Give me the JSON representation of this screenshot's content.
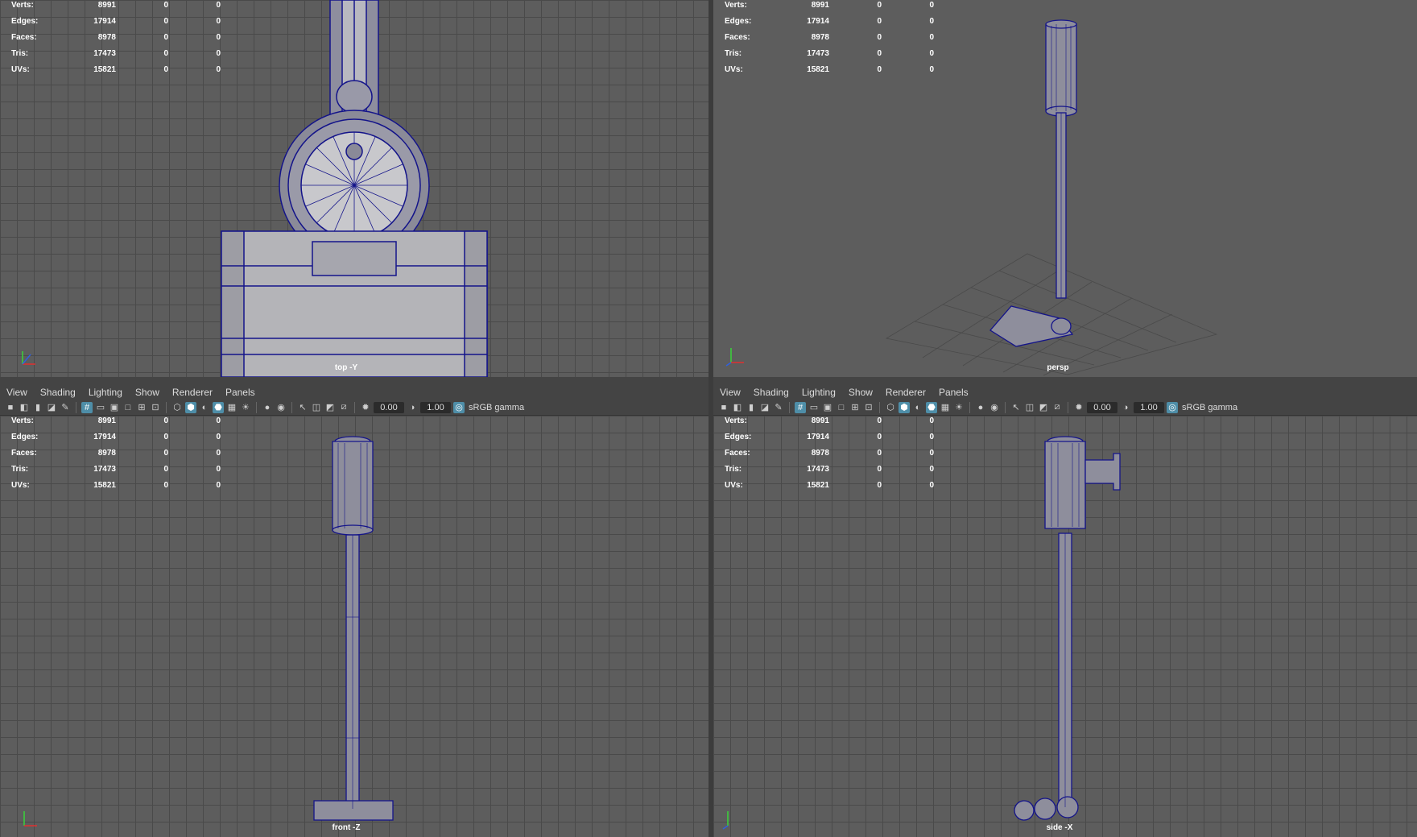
{
  "menu": [
    "View",
    "Shading",
    "Lighting",
    "Show",
    "Renderer",
    "Panels"
  ],
  "toolbar": {
    "exposure": "0.00",
    "gamma_value": "1.00",
    "color_space": "sRGB gamma"
  },
  "hud": {
    "rows": [
      {
        "label": "Verts:",
        "value": "8991",
        "c1": "0",
        "c2": "0"
      },
      {
        "label": "Edges:",
        "value": "17914",
        "c1": "0",
        "c2": "0"
      },
      {
        "label": "Faces:",
        "value": "8978",
        "c1": "0",
        "c2": "0"
      },
      {
        "label": "Tris:",
        "value": "17473",
        "c1": "0",
        "c2": "0"
      },
      {
        "label": "UVs:",
        "value": "15821",
        "c1": "0",
        "c2": "0"
      }
    ]
  },
  "viewports": {
    "top": {
      "camera": "top -Y"
    },
    "persp": {
      "camera": "persp"
    },
    "front": {
      "camera": "front -Z"
    },
    "side": {
      "camera": "side -X"
    }
  },
  "colors": {
    "wire": "#14148a",
    "viewport_bg": "#5d5d5d",
    "accent": "#4e8ea8"
  }
}
